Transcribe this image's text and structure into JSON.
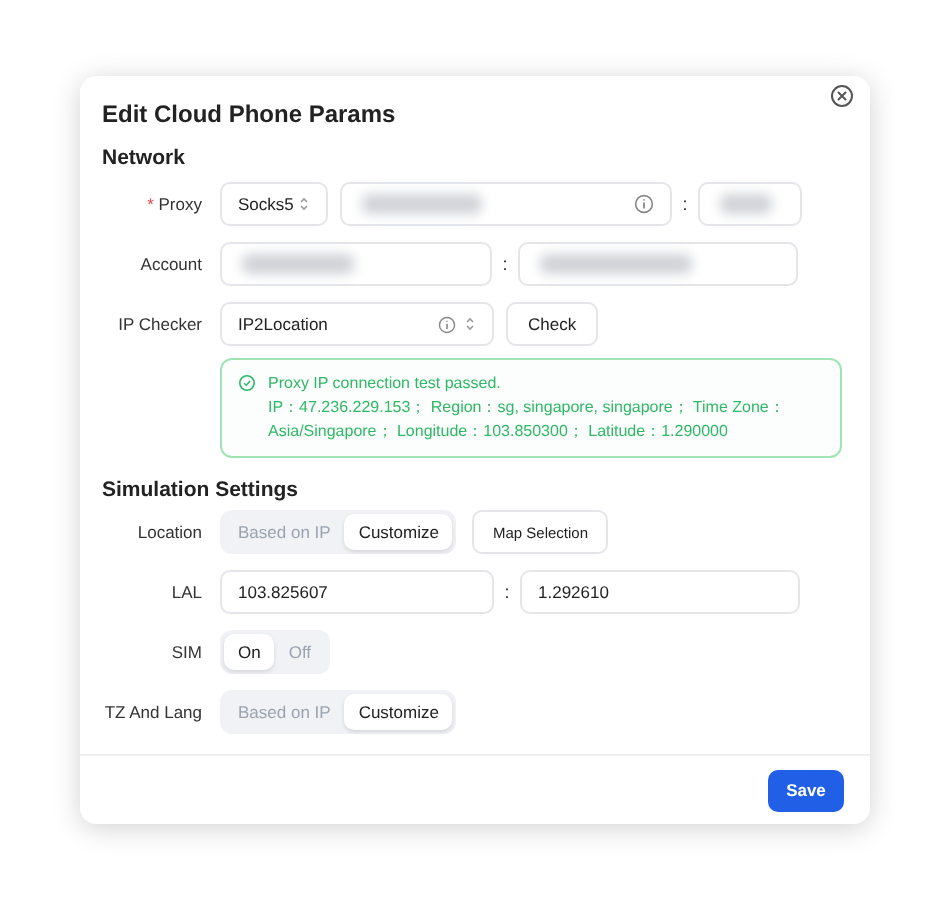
{
  "dialog": {
    "title": "Edit Cloud Phone Params",
    "network": {
      "title": "Network",
      "proxy": {
        "label": "Proxy",
        "required_mark": "*",
        "type": "Socks5",
        "host": {
          "redacted": true
        },
        "separator": ":",
        "port": {
          "redacted": true
        }
      },
      "account": {
        "label": "Account",
        "username": {
          "redacted": true
        },
        "separator": ":",
        "password": {
          "redacted": true
        }
      },
      "ip_checker": {
        "label": "IP Checker",
        "value": "IP2Location",
        "button": "Check"
      },
      "result": {
        "passed": true,
        "title": "Proxy IP connection test passed.",
        "details": "IP：47.236.229.153；  Region：sg, singapore, singapore；  Time Zone：Asia/Singapore；  Longitude：103.850300；  Latitude：1.290000"
      }
    },
    "simulation": {
      "title": "Simulation Settings",
      "rows": [
        {
          "kind": "segmented",
          "label": "Location",
          "options": [
            {
              "label": "Based on IP",
              "selected": false
            },
            {
              "label": "Customize",
              "selected": true
            }
          ],
          "button": "Map Selection"
        },
        {
          "kind": "pair",
          "label": "LAL",
          "values": [
            "103.825607",
            "1.292610"
          ],
          "separator": ":"
        },
        {
          "kind": "segmented",
          "label": "SIM",
          "options": [
            {
              "label": "On",
              "selected": true
            },
            {
              "label": "Off",
              "selected": false
            }
          ]
        },
        {
          "kind": "segmented",
          "label": "TZ And Lang",
          "options": [
            {
              "label": "Based on IP",
              "selected": false
            },
            {
              "label": "Customize",
              "selected": true
            }
          ]
        }
      ]
    },
    "footer": {
      "save": "Save"
    }
  }
}
